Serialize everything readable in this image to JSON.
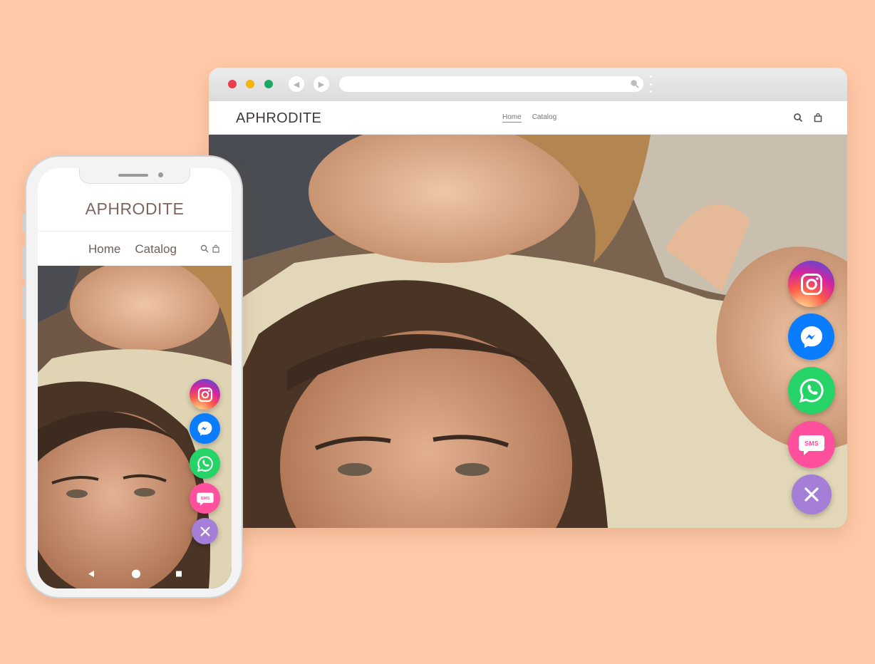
{
  "browser": {
    "window_dots": [
      "#ea3c4f",
      "#f5b30c",
      "#1ea866"
    ]
  },
  "desktop_site": {
    "brand": "APHRODITE",
    "nav": [
      "Home",
      "Catalog"
    ],
    "active_nav": "Home",
    "header_icons": [
      "search-icon",
      "bag-icon"
    ]
  },
  "mobile_site": {
    "brand": "APHRODITE",
    "nav": [
      "Home",
      "Catalog"
    ],
    "header_icons": [
      "search-icon",
      "bag-icon"
    ]
  },
  "chat_widget": {
    "buttons": [
      {
        "name": "instagram",
        "icon": "instagram-icon",
        "color": "#d6249f"
      },
      {
        "name": "messenger",
        "icon": "messenger-icon",
        "color": "#0a7cff"
      },
      {
        "name": "whatsapp",
        "icon": "whatsapp-icon",
        "color": "#25d366"
      },
      {
        "name": "sms",
        "icon": "sms-icon",
        "label": "SMS",
        "color": "#ff4f9d"
      },
      {
        "name": "close",
        "icon": "close-icon",
        "color": "#a57ed8"
      }
    ]
  },
  "colors": {
    "background": "#ffcaa9",
    "brand_text": "#3f3a37"
  }
}
